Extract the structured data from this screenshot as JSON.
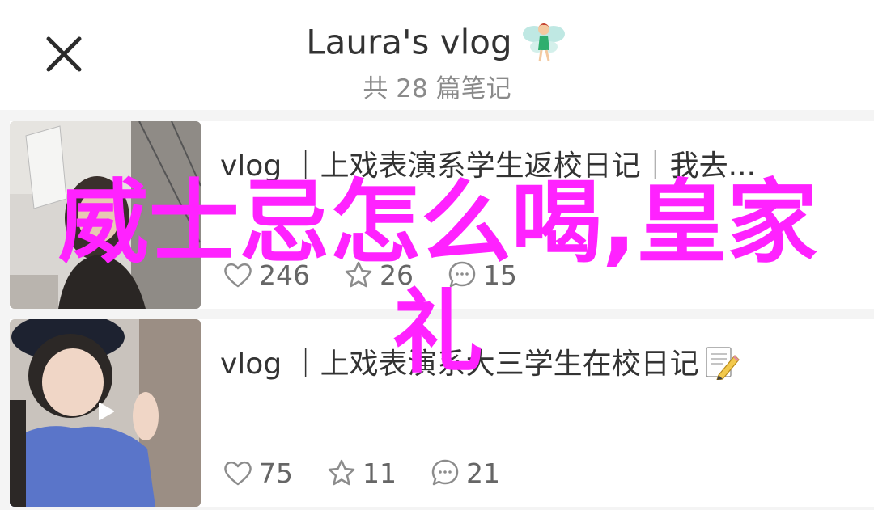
{
  "header": {
    "title": "Laura's vlog",
    "title_emoji_icon": "fairy-icon",
    "subtitle": "共 28 篇笔记",
    "close_icon": "close-icon"
  },
  "notes": [
    {
      "title": "vlog ｜上戏表演系学生返校日记｜我去...",
      "likes": "246",
      "favorites": "26",
      "comments": "15",
      "has_video": false
    },
    {
      "title": "vlog ｜上戏表演系大三学生在校日记",
      "title_emoji_icon": "memo-pencil-icon",
      "likes": "75",
      "favorites": "11",
      "comments": "21",
      "has_video": true
    }
  ],
  "overlay_text": "威士忌怎么喝,皇家礼",
  "colors": {
    "overlay": "#ff22ff",
    "text": "#333333",
    "muted": "#8a8a8a",
    "background": "#f4f4f4"
  }
}
